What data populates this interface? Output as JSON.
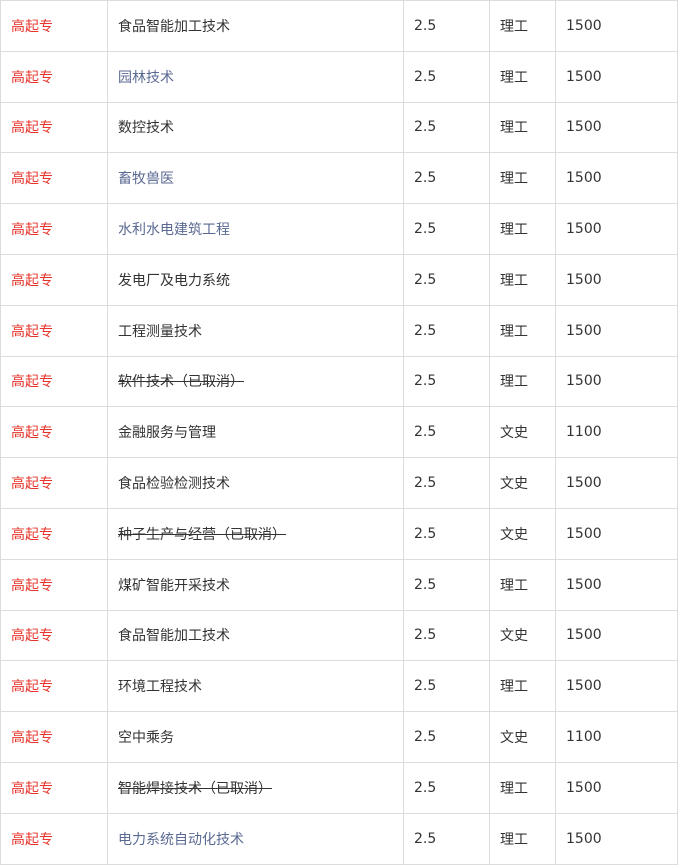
{
  "colors": {
    "level_text": "#e8342b",
    "link_text": "#5b6a93",
    "body_text": "#333333",
    "border": "#dcdcdc"
  },
  "rows": [
    {
      "level": "高起专",
      "major": "食品智能加工技术",
      "years": "2.5",
      "type": "理工",
      "fee": "1500",
      "link": false,
      "cancelled": false
    },
    {
      "level": "高起专",
      "major": "园林技术",
      "years": "2.5",
      "type": "理工",
      "fee": "1500",
      "link": true,
      "cancelled": false
    },
    {
      "level": "高起专",
      "major": "数控技术",
      "years": "2.5",
      "type": "理工",
      "fee": "1500",
      "link": false,
      "cancelled": false
    },
    {
      "level": "高起专",
      "major": "畜牧兽医",
      "years": "2.5",
      "type": "理工",
      "fee": "1500",
      "link": true,
      "cancelled": false
    },
    {
      "level": "高起专",
      "major": "水利水电建筑工程",
      "years": "2.5",
      "type": "理工",
      "fee": "1500",
      "link": true,
      "cancelled": false
    },
    {
      "level": "高起专",
      "major": "发电厂及电力系统",
      "years": "2.5",
      "type": "理工",
      "fee": "1500",
      "link": false,
      "cancelled": false
    },
    {
      "level": "高起专",
      "major": "工程测量技术",
      "years": "2.5",
      "type": "理工",
      "fee": "1500",
      "link": false,
      "cancelled": false
    },
    {
      "level": "高起专",
      "major": "软件技术（已取消）",
      "years": "2.5",
      "type": "理工",
      "fee": "1500",
      "link": false,
      "cancelled": true
    },
    {
      "level": "高起专",
      "major": "金融服务与管理",
      "years": "2.5",
      "type": "文史",
      "fee": "1100",
      "link": false,
      "cancelled": false
    },
    {
      "level": "高起专",
      "major": "食品检验检测技术",
      "years": "2.5",
      "type": "文史",
      "fee": "1500",
      "link": false,
      "cancelled": false
    },
    {
      "level": "高起专",
      "major": "种子生产与经营（已取消）",
      "years": "2.5",
      "type": "文史",
      "fee": "1500",
      "link": false,
      "cancelled": true
    },
    {
      "level": "高起专",
      "major": "煤矿智能开采技术",
      "years": "2.5",
      "type": "理工",
      "fee": "1500",
      "link": false,
      "cancelled": false
    },
    {
      "level": "高起专",
      "major": "食品智能加工技术",
      "years": "2.5",
      "type": "文史",
      "fee": "1500",
      "link": false,
      "cancelled": false
    },
    {
      "level": "高起专",
      "major": "环境工程技术",
      "years": "2.5",
      "type": "理工",
      "fee": "1500",
      "link": false,
      "cancelled": false
    },
    {
      "level": "高起专",
      "major": "空中乘务",
      "years": "2.5",
      "type": "文史",
      "fee": "1100",
      "link": false,
      "cancelled": false
    },
    {
      "level": "高起专",
      "major": "智能焊接技术（已取消）",
      "years": "2.5",
      "type": "理工",
      "fee": "1500",
      "link": false,
      "cancelled": true
    },
    {
      "level": "高起专",
      "major": "电力系统自动化技术",
      "years": "2.5",
      "type": "理工",
      "fee": "1500",
      "link": true,
      "cancelled": false
    }
  ]
}
